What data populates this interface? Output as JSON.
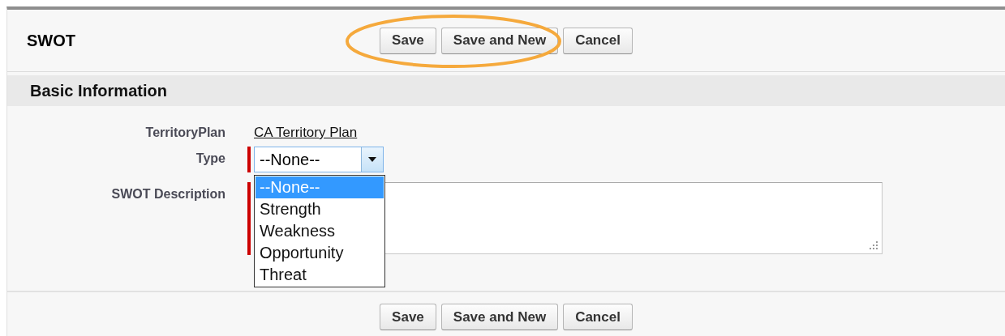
{
  "header": {
    "title": "SWOT",
    "buttons": [
      "Save",
      "Save and New",
      "Cancel"
    ]
  },
  "section": {
    "title": "Basic Information"
  },
  "fields": [
    {
      "kind": "link",
      "label": "TerritoryPlan",
      "value": "CA Territory Plan",
      "required": false
    },
    {
      "kind": "select",
      "label": "Type",
      "value": "--None--",
      "required": true,
      "expanded": true,
      "options": [
        {
          "label": "--None--",
          "selected": true
        },
        {
          "label": "Strength",
          "selected": false
        },
        {
          "label": "Weakness",
          "selected": false
        },
        {
          "label": "Opportunity",
          "selected": false
        },
        {
          "label": "Threat",
          "selected": false
        }
      ]
    },
    {
      "kind": "textarea",
      "label": "SWOT Description",
      "required": true
    }
  ],
  "footer": {
    "buttons": [
      "Save",
      "Save and New",
      "Cancel"
    ]
  }
}
